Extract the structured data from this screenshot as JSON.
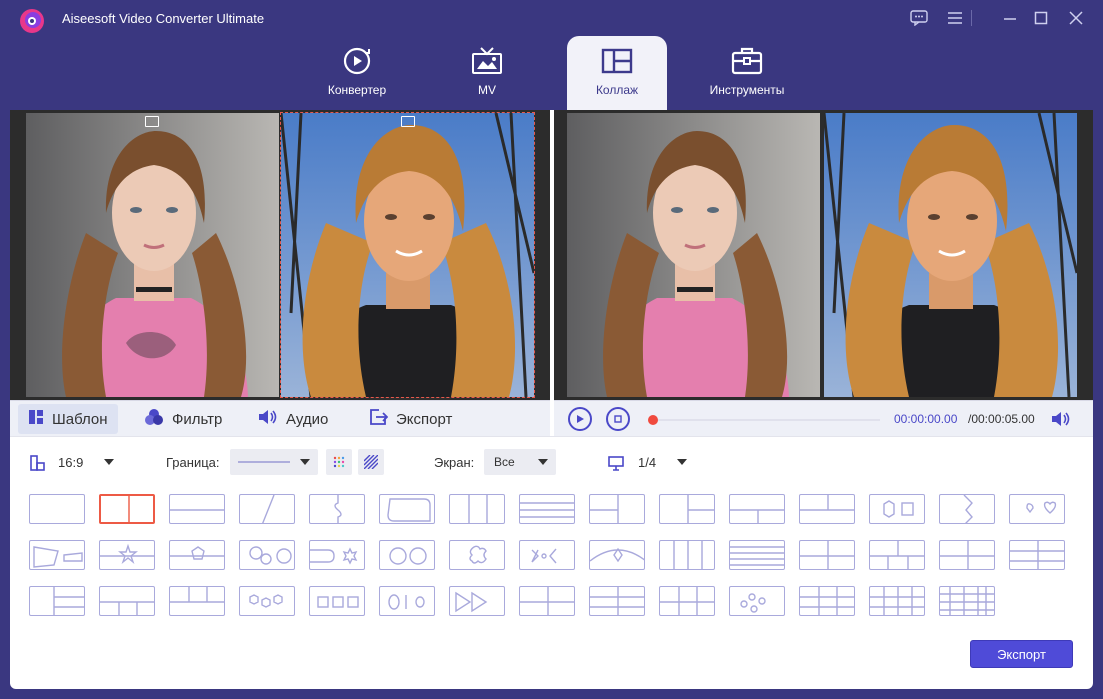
{
  "app": {
    "title": "Aiseesoft Video Converter Ultimate"
  },
  "tabs": [
    {
      "label": "Конвертер",
      "icon": "convert-icon",
      "active": false
    },
    {
      "label": "MV",
      "icon": "mv-icon",
      "active": false
    },
    {
      "label": "Коллаж",
      "icon": "collage-icon",
      "active": true
    },
    {
      "label": "Инструменты",
      "icon": "toolbox-icon",
      "active": false
    }
  ],
  "tool_tabs": [
    {
      "label": "Шаблон",
      "icon": "template-icon",
      "active": true
    },
    {
      "label": "Фильтр",
      "icon": "filter-icon",
      "active": false
    },
    {
      "label": "Аудио",
      "icon": "audio-icon",
      "active": false
    },
    {
      "label": "Экспорт",
      "icon": "export-icon",
      "active": false
    }
  ],
  "player": {
    "current_time": "00:00:00.00",
    "total_time": "/00:00:05.00",
    "progress": 0
  },
  "settings": {
    "aspect": "16:9",
    "border_label": "Граница:",
    "screen_label": "Экран:",
    "screen_value": "Все",
    "page": "1/4"
  },
  "templates": {
    "count": 44,
    "selected_index": 1
  },
  "export_button": "Экспорт",
  "colors": {
    "accent": "#4f4bd8",
    "title_bar": "#3a3780",
    "selection": "#ed5a45",
    "template_stroke": "#a9a9dc"
  }
}
